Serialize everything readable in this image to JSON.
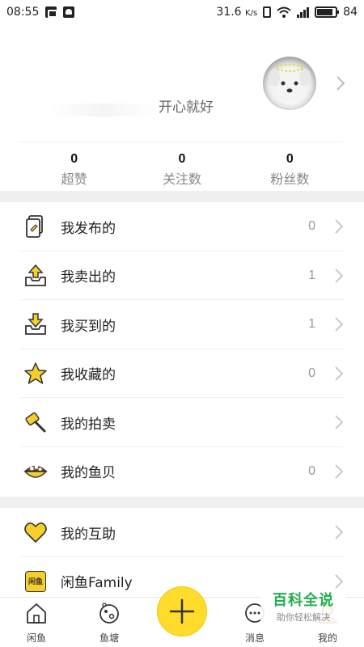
{
  "status_bar": {
    "time": "08:55",
    "network_speed": "31.6",
    "speed_unit": "K/s",
    "battery": "84"
  },
  "profile": {
    "signature": "开心就好"
  },
  "stats": [
    {
      "value": "0",
      "label": "超赞"
    },
    {
      "value": "0",
      "label": "关注数"
    },
    {
      "value": "0",
      "label": "粉丝数"
    }
  ],
  "menu_group1": [
    {
      "label": "我发布的",
      "count": "0",
      "icon": "document-icon"
    },
    {
      "label": "我卖出的",
      "count": "1",
      "icon": "sold-box-icon"
    },
    {
      "label": "我买到的",
      "count": "1",
      "icon": "bought-box-icon"
    },
    {
      "label": "我收藏的",
      "count": "0",
      "icon": "star-icon"
    },
    {
      "label": "我的拍卖",
      "count": "",
      "icon": "auction-hammer-icon"
    },
    {
      "label": "我的鱼贝",
      "count": "0",
      "icon": "shell-icon"
    }
  ],
  "menu_group2": [
    {
      "label": "我的互助",
      "count": "",
      "icon": "heart-icon"
    },
    {
      "label": "闲鱼Family",
      "count": "",
      "icon": "family-badge-icon"
    }
  ],
  "family_badge_text": "闲鱼",
  "tabs": [
    {
      "label": "闲鱼",
      "icon": "home-icon"
    },
    {
      "label": "鱼塘",
      "icon": "pond-icon"
    },
    {
      "label": "消息",
      "icon": "message-icon"
    },
    {
      "label": "我的",
      "icon": "profile-icon"
    }
  ],
  "watermark": {
    "title": "百科全说",
    "subtitle": "助你轻松解决"
  },
  "colors": {
    "accent_yellow": "#ffdb2b",
    "icon_yellow": "#f7cf2a",
    "watermark_green": "#1fae4a"
  }
}
